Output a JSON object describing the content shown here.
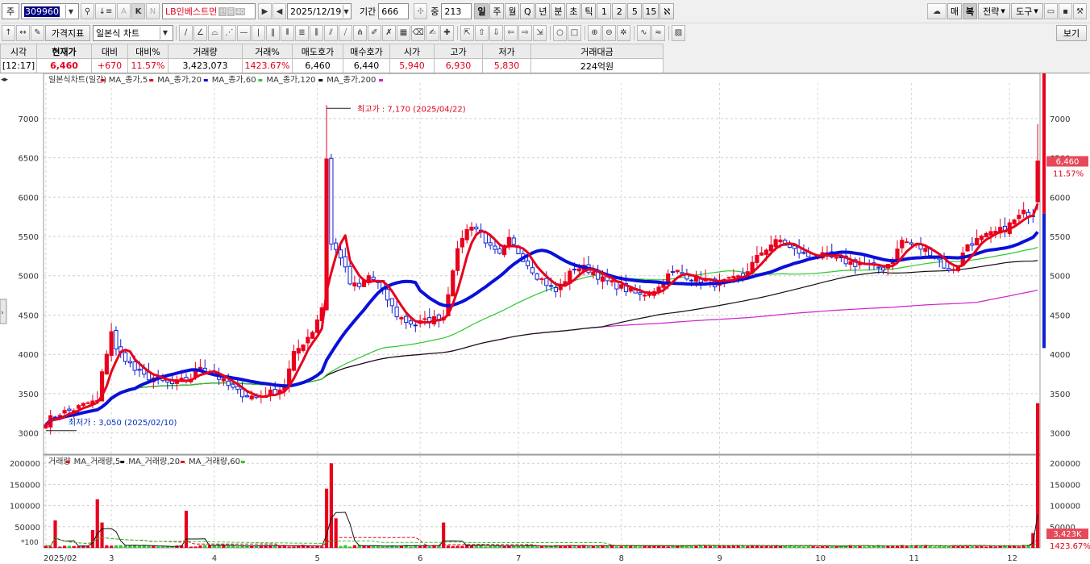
{
  "toolbar1": {
    "market_label": "주",
    "stock_code": "309960",
    "stock_name": "LB인베스트먼",
    "sm_badges": [
      "신",
      "증",
      "40"
    ],
    "date": "2025/12/19",
    "period_label": "기간",
    "period_value": "666",
    "zoom_label": "중",
    "zoom_value": "213",
    "interval_buttons": [
      "일",
      "주",
      "월",
      "Q",
      "년",
      "분",
      "초",
      "틱",
      "1",
      "2",
      "5",
      "15"
    ],
    "right_buttons": [
      "매",
      "복",
      "전략",
      "도구"
    ]
  },
  "toolbar2": {
    "indicator_button": "가격지표",
    "chart_type": "일본식 차트",
    "view_button": "보기"
  },
  "quote": {
    "headers": [
      "시각",
      "현재가",
      "대비",
      "대비%",
      "거래량",
      "거래%",
      "매도호가",
      "매수호가",
      "시가",
      "고가",
      "저가",
      "거래대금"
    ],
    "values": [
      "[12:17]",
      "6,460",
      "+670",
      "11.57%",
      "3,423,073",
      "1423.67%",
      "6,460",
      "6,440",
      "5,940",
      "6,930",
      "5,830",
      "224억원"
    ]
  },
  "chart_data": {
    "type": "candlestick",
    "price_legend": [
      "일본식차트(일간)",
      "MA_종가,5",
      "MA_종가,20",
      "MA_종가,60",
      "MA_종가,120",
      "MA_종가,200"
    ],
    "volume_legend": [
      "거래량",
      "MA_거래량,5",
      "MA_거래량,20",
      "MA_거래량,60"
    ],
    "price_ticks": [
      3000,
      3500,
      4000,
      4500,
      5000,
      5500,
      6000,
      6500,
      7000
    ],
    "price_ylim": [
      2750,
      7450
    ],
    "volume_ticks": [
      50000,
      100000,
      150000,
      200000
    ],
    "volume_ylim": [
      0,
      210000
    ],
    "volume_unit_label": "*100",
    "x_labels": [
      "2025/02",
      "3",
      "4",
      "5",
      "6",
      "7",
      "8",
      "9",
      "10",
      "11",
      "12"
    ],
    "annotations": {
      "high": "최고가 : 7,170 (2025/04/22)",
      "low": "최저가 : 3,050 (2025/02/10)"
    },
    "last_price": "6,460",
    "last_change": "11.57%",
    "last_volume": "3,423K",
    "last_volume_pct": "1423.67%",
    "anchors": [
      [
        0,
        3150
      ],
      [
        3,
        3250
      ],
      [
        6,
        3300
      ],
      [
        9,
        3380
      ],
      [
        11,
        3400
      ],
      [
        12,
        3750
      ],
      [
        14,
        4300
      ],
      [
        15,
        4050
      ],
      [
        17,
        3950
      ],
      [
        19,
        3800
      ],
      [
        21,
        3720
      ],
      [
        23,
        3700
      ],
      [
        25,
        3650
      ],
      [
        27,
        3620
      ],
      [
        29,
        3660
      ],
      [
        31,
        3700
      ],
      [
        33,
        3850
      ],
      [
        35,
        3780
      ],
      [
        37,
        3700
      ],
      [
        39,
        3600
      ],
      [
        41,
        3520
      ],
      [
        43,
        3480
      ],
      [
        45,
        3450
      ],
      [
        47,
        3500
      ],
      [
        49,
        3520
      ],
      [
        51,
        3600
      ],
      [
        53,
        4000
      ],
      [
        55,
        4150
      ],
      [
        57,
        4300
      ],
      [
        59,
        4600
      ],
      [
        60,
        6500
      ],
      [
        61,
        5400
      ],
      [
        63,
        5250
      ],
      [
        65,
        4900
      ],
      [
        67,
        4850
      ],
      [
        69,
        5000
      ],
      [
        71,
        4900
      ],
      [
        73,
        4700
      ],
      [
        75,
        4500
      ],
      [
        77,
        4420
      ],
      [
        79,
        4380
      ],
      [
        81,
        4420
      ],
      [
        83,
        4450
      ],
      [
        85,
        4480
      ],
      [
        87,
        5100
      ],
      [
        89,
        5500
      ],
      [
        91,
        5650
      ],
      [
        93,
        5550
      ],
      [
        95,
        5350
      ],
      [
        97,
        5250
      ],
      [
        99,
        5450
      ],
      [
        101,
        5300
      ],
      [
        103,
        5150
      ],
      [
        105,
        5000
      ],
      [
        107,
        4900
      ],
      [
        109,
        4800
      ],
      [
        111,
        4950
      ],
      [
        113,
        5100
      ],
      [
        115,
        5100
      ],
      [
        117,
        5050
      ],
      [
        119,
        4950
      ],
      [
        121,
        4900
      ],
      [
        123,
        4850
      ],
      [
        125,
        4800
      ],
      [
        127,
        4750
      ],
      [
        129,
        4800
      ],
      [
        131,
        4850
      ],
      [
        133,
        5000
      ],
      [
        135,
        5050
      ],
      [
        137,
        5000
      ],
      [
        139,
        4950
      ],
      [
        141,
        4950
      ],
      [
        143,
        4900
      ],
      [
        145,
        4920
      ],
      [
        147,
        4950
      ],
      [
        149,
        5000
      ],
      [
        151,
        5150
      ],
      [
        153,
        5300
      ],
      [
        155,
        5400
      ],
      [
        157,
        5450
      ],
      [
        159,
        5350
      ],
      [
        161,
        5300
      ],
      [
        163,
        5250
      ],
      [
        165,
        5250
      ],
      [
        167,
        5250
      ],
      [
        169,
        5200
      ],
      [
        171,
        5180
      ],
      [
        173,
        5150
      ],
      [
        175,
        5150
      ],
      [
        177,
        5100
      ],
      [
        179,
        5100
      ],
      [
        181,
        5200
      ],
      [
        183,
        5450
      ],
      [
        185,
        5400
      ],
      [
        187,
        5350
      ],
      [
        189,
        5300
      ],
      [
        191,
        5200
      ],
      [
        193,
        5050
      ],
      [
        195,
        5150
      ],
      [
        197,
        5400
      ],
      [
        199,
        5450
      ],
      [
        201,
        5500
      ],
      [
        203,
        5550
      ],
      [
        205,
        5600
      ],
      [
        207,
        5700
      ],
      [
        209,
        5800
      ],
      [
        211,
        5790
      ],
      [
        212,
        6460
      ]
    ],
    "volume_spikes": [
      [
        2,
        650
      ],
      [
        10,
        420
      ],
      [
        11,
        1150
      ],
      [
        12,
        600
      ],
      [
        30,
        880
      ],
      [
        60,
        1400
      ],
      [
        61,
        2000
      ],
      [
        62,
        700
      ],
      [
        85,
        600
      ],
      [
        211,
        350
      ],
      [
        212,
        3423
      ]
    ]
  },
  "colors": {
    "up": "#e8001c",
    "down": "#1020d0",
    "ma5": "#e8001c",
    "ma20": "#0a10d8",
    "ma60": "#2ec82e",
    "ma120": "#111111",
    "ma200": "#d020d0"
  }
}
